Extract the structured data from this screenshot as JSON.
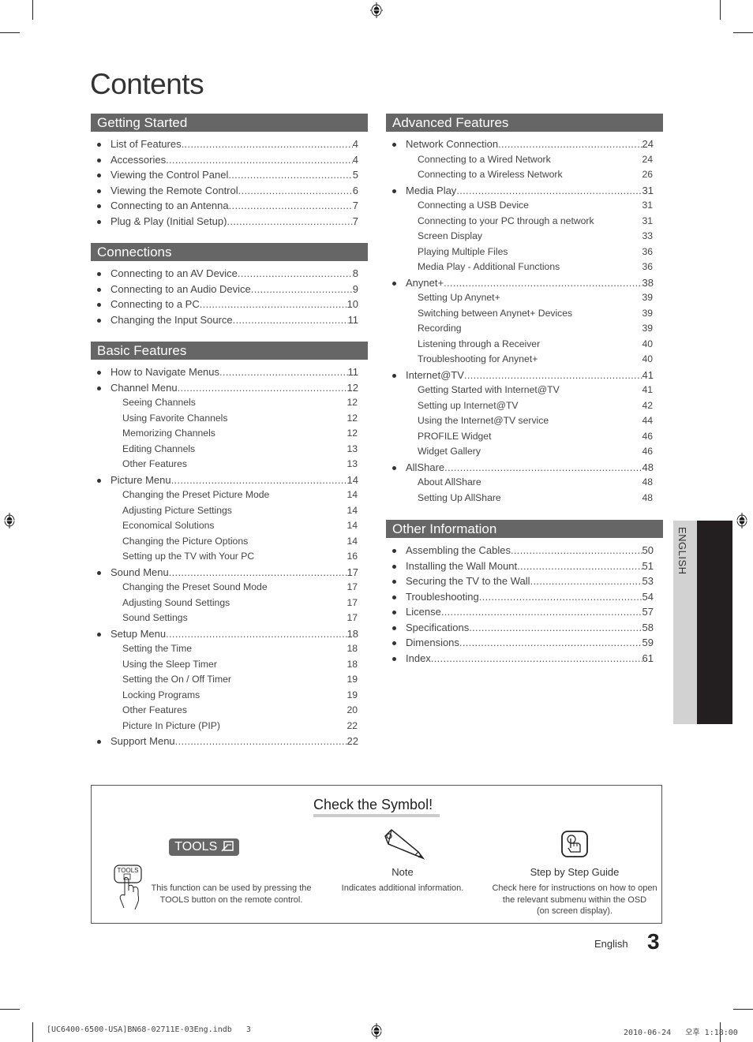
{
  "title": "Contents",
  "left_column": [
    {
      "heading": "Getting Started",
      "items": [
        {
          "label": "List of Features",
          "page": "4"
        },
        {
          "label": "Accessories",
          "page": "4"
        },
        {
          "label": "Viewing the Control Panel",
          "page": "5"
        },
        {
          "label": "Viewing the Remote Control",
          "page": "6"
        },
        {
          "label": "Connecting to an Antenna",
          "page": "7"
        },
        {
          "label": "Plug & Play (Initial Setup)",
          "page": "7"
        }
      ]
    },
    {
      "heading": "Connections",
      "items": [
        {
          "label": "Connecting to an AV Device",
          "page": "8"
        },
        {
          "label": "Connecting to an Audio Device",
          "page": "9"
        },
        {
          "label": "Connecting to a PC",
          "page": "10"
        },
        {
          "label": "Changing the Input Source",
          "page": "11"
        }
      ]
    },
    {
      "heading": "Basic Features",
      "items": [
        {
          "label": "How to Navigate Menus",
          "page": "11"
        },
        {
          "label": "Channel Menu",
          "page": "12",
          "sub": [
            {
              "label": "Seeing Channels",
              "page": "12"
            },
            {
              "label": "Using Favorite Channels",
              "page": "12"
            },
            {
              "label": "Memorizing Channels",
              "page": "12"
            },
            {
              "label": "Editing Channels",
              "page": "13"
            },
            {
              "label": "Other Features",
              "page": "13"
            }
          ]
        },
        {
          "label": "Picture Menu",
          "page": "14",
          "sub": [
            {
              "label": "Changing the Preset Picture Mode",
              "page": "14"
            },
            {
              "label": "Adjusting Picture Settings",
              "page": "14"
            },
            {
              "label": "Economical Solutions",
              "page": "14"
            },
            {
              "label": "Changing the Picture Options",
              "page": "14"
            },
            {
              "label": "Setting up the TV with Your PC",
              "page": "16"
            }
          ]
        },
        {
          "label": "Sound Menu",
          "page": "17",
          "sub": [
            {
              "label": "Changing the Preset Sound Mode",
              "page": "17"
            },
            {
              "label": "Adjusting Sound Settings",
              "page": "17"
            },
            {
              "label": "Sound Settings",
              "page": "17"
            }
          ]
        },
        {
          "label": "Setup Menu",
          "page": "18",
          "sub": [
            {
              "label": "Setting the Time",
              "page": "18"
            },
            {
              "label": "Using the Sleep Timer",
              "page": "18"
            },
            {
              "label": "Setting the On / Off Timer",
              "page": "19"
            },
            {
              "label": "Locking Programs",
              "page": "19"
            },
            {
              "label": "Other Features",
              "page": "20"
            },
            {
              "label": "Picture In Picture (PIP)",
              "page": "22"
            }
          ]
        },
        {
          "label": "Support Menu",
          "page": "22"
        }
      ]
    }
  ],
  "right_column": [
    {
      "heading": "Advanced Features",
      "items": [
        {
          "label": "Network Connection",
          "page": "24",
          "sub": [
            {
              "label": "Connecting to a Wired Network",
              "page": "24"
            },
            {
              "label": "Connecting to a Wireless Network",
              "page": "26"
            }
          ]
        },
        {
          "label": "Media Play",
          "page": "31",
          "sub": [
            {
              "label": "Connecting a USB Device",
              "page": "31"
            },
            {
              "label": "Connecting to your PC through a network",
              "page": "31"
            },
            {
              "label": "Screen Display",
              "page": "33"
            },
            {
              "label": "Playing Multiple Files",
              "page": "36"
            },
            {
              "label": "Media Play - Additional Functions",
              "page": "36"
            }
          ]
        },
        {
          "label": "Anynet+",
          "page": "38",
          "sub": [
            {
              "label": "Setting Up Anynet+",
              "page": "39"
            },
            {
              "label": "Switching between Anynet+ Devices",
              "page": "39"
            },
            {
              "label": "Recording",
              "page": "39"
            },
            {
              "label": "Listening through a Receiver",
              "page": "40"
            },
            {
              "label": "Troubleshooting for Anynet+",
              "page": "40"
            }
          ]
        },
        {
          "label": "Internet@TV",
          "page": "41",
          "sub": [
            {
              "label": "Getting Started with Internet@TV",
              "page": "41"
            },
            {
              "label": "Setting up Internet@TV",
              "page": "42"
            },
            {
              "label": "Using the Internet@TV service",
              "page": "44"
            },
            {
              "label": "PROFILE Widget",
              "page": "46"
            },
            {
              "label": "Widget Gallery",
              "page": "46"
            }
          ]
        },
        {
          "label": "AllShare",
          "page": "48",
          "sub": [
            {
              "label": "About AllShare",
              "page": "48"
            },
            {
              "label": "Setting Up AllShare",
              "page": "48"
            }
          ]
        }
      ]
    },
    {
      "heading": "Other Information",
      "items": [
        {
          "label": "Assembling the Cables",
          "page": "50"
        },
        {
          "label": "Installing the Wall Mount",
          "page": "51"
        },
        {
          "label": "Securing the TV to the Wall",
          "page": "53"
        },
        {
          "label": "Troubleshooting",
          "page": "54"
        },
        {
          "label": "License",
          "page": "57"
        },
        {
          "label": "Specifications",
          "page": "58"
        },
        {
          "label": "Dimensions",
          "page": "59"
        },
        {
          "label": "Index",
          "page": "61"
        }
      ]
    }
  ],
  "language_tab": "ENGLISH",
  "symbols": {
    "title": "Check the Symbol!",
    "tools": {
      "badge": "TOOLS",
      "remote_button": "TOOLS",
      "desc_line1": "This function can be used by pressing the",
      "desc_line2": "TOOLS button on the remote control."
    },
    "note": {
      "label": "Note",
      "desc": "Indicates additional information."
    },
    "guide": {
      "label": "Step by Step Guide",
      "desc_line1": "Check here for instructions on how to open",
      "desc_line2": "the relevant submenu within the OSD",
      "desc_line3": "(on screen display)."
    }
  },
  "footer": {
    "language": "English",
    "page_number": "3"
  },
  "print_slug": {
    "file": "[UC6400-6500-USA]BN68-02711E-03Eng.indb   3",
    "timestamp": "2010-06-24   오후 1:18:00"
  },
  "colors": {
    "section_header": "#666666",
    "tab_light": "#d2d2d2",
    "tab_dark": "#231f20"
  }
}
